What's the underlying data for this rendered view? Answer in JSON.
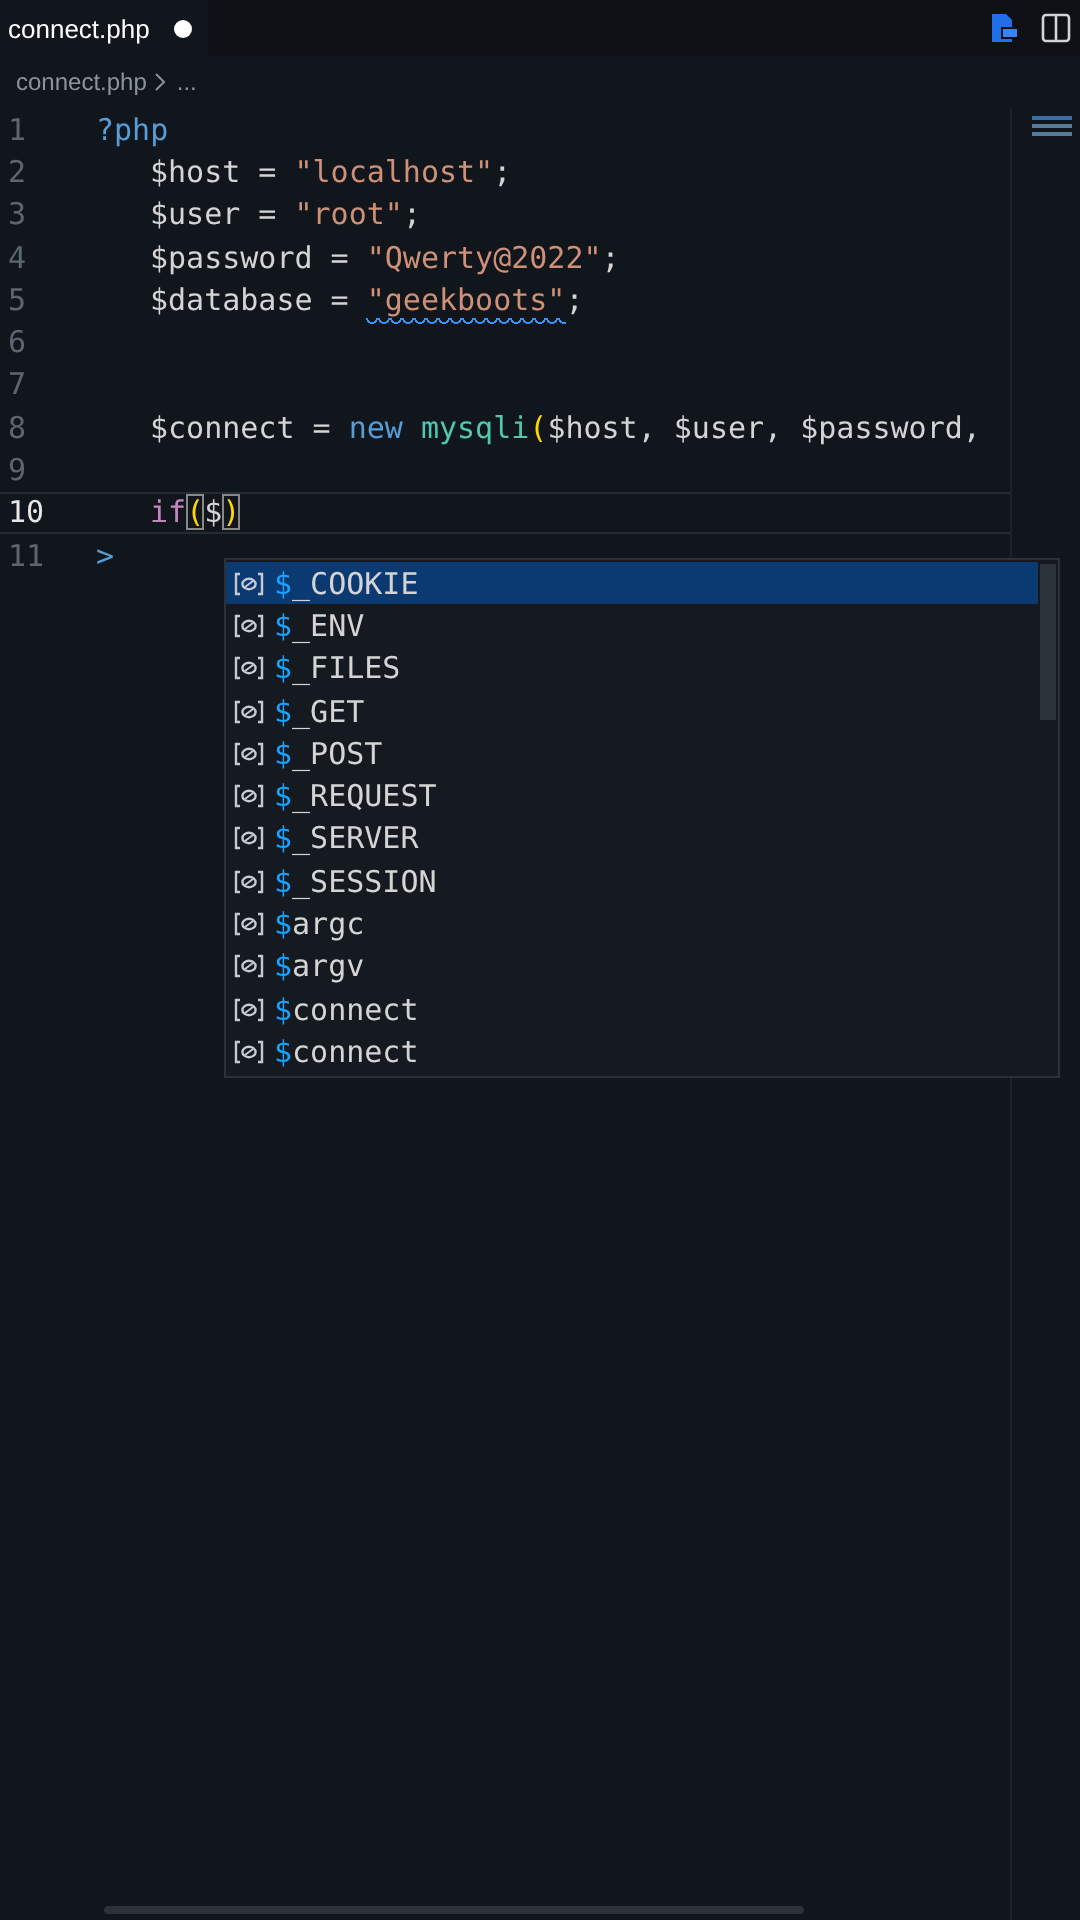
{
  "tab": {
    "label": "connect.php",
    "modified": true,
    "selected": true
  },
  "breadcrumb": [
    "connect.php",
    "..."
  ],
  "editor": {
    "lines": [
      {
        "number": "1",
        "indented": false,
        "current": false,
        "tokens": [
          {
            "kind": "keyword",
            "text": "?php"
          }
        ]
      },
      {
        "number": "2",
        "indented": true,
        "current": false,
        "tokens": [
          {
            "kind": "variable",
            "text": "$host"
          },
          {
            "kind": "plain",
            "text": " = "
          },
          {
            "kind": "string",
            "text": "\"localhost\""
          },
          {
            "kind": "plain",
            "text": ";"
          }
        ]
      },
      {
        "number": "3",
        "indented": true,
        "current": false,
        "tokens": [
          {
            "kind": "variable",
            "text": "$user"
          },
          {
            "kind": "plain",
            "text": " = "
          },
          {
            "kind": "string",
            "text": "\"root\""
          },
          {
            "kind": "plain",
            "text": ";"
          }
        ]
      },
      {
        "number": "4",
        "indented": true,
        "current": false,
        "tokens": [
          {
            "kind": "variable",
            "text": "$password"
          },
          {
            "kind": "plain",
            "text": " = "
          },
          {
            "kind": "string",
            "text": "\"Qwerty@2022\""
          },
          {
            "kind": "plain",
            "text": ";"
          }
        ]
      },
      {
        "number": "5",
        "indented": true,
        "current": false,
        "tokens": [
          {
            "kind": "variable",
            "text": "$database"
          },
          {
            "kind": "plain",
            "text": " = "
          },
          {
            "kind": "string",
            "text": "\"geekboots\"",
            "squiggle": true
          },
          {
            "kind": "plain",
            "text": ";"
          }
        ]
      },
      {
        "number": "6",
        "current": false
      },
      {
        "number": "7",
        "current": false
      },
      {
        "number": "8",
        "indented": true,
        "current": false,
        "tokens": [
          {
            "kind": "variable",
            "text": "$connect"
          },
          {
            "kind": "plain",
            "text": " = "
          },
          {
            "kind": "keyword",
            "text": "new "
          },
          {
            "kind": "function",
            "text": "mysqli"
          },
          {
            "kind": "paren",
            "text": "("
          },
          {
            "kind": "variable",
            "text": "$host, "
          },
          {
            "kind": "variable",
            "text": "$user, "
          },
          {
            "kind": "variable",
            "text": "$password,"
          }
        ]
      },
      {
        "number": "9",
        "current": false
      },
      {
        "number": "10",
        "indented": true,
        "current": true,
        "tokens": [
          {
            "kind": "control",
            "text": "if"
          },
          {
            "kind": "paren",
            "text": "(",
            "bracket_match": true
          },
          {
            "kind": "variable",
            "text": "$"
          },
          {
            "kind": "paren",
            "text": ")",
            "bracket_match": true
          }
        ]
      },
      {
        "number": "11",
        "indented": false,
        "current": false,
        "tokens": [
          {
            "kind": "fold",
            "text": ">"
          }
        ]
      }
    ]
  },
  "suggestions": [
    {
      "match": "$",
      "rest": "_COOKIE",
      "selected": true
    },
    {
      "match": "$",
      "rest": "_ENV",
      "selected": false
    },
    {
      "match": "$",
      "rest": "_FILES",
      "selected": false
    },
    {
      "match": "$",
      "rest": "_GET",
      "selected": false
    },
    {
      "match": "$",
      "rest": "_POST",
      "selected": false
    },
    {
      "match": "$",
      "rest": "_REQUEST",
      "selected": false
    },
    {
      "match": "$",
      "rest": "_SERVER",
      "selected": false
    },
    {
      "match": "$",
      "rest": "_SESSION",
      "selected": false
    },
    {
      "match": "$",
      "rest": "argc",
      "selected": false
    },
    {
      "match": "$",
      "rest": "argv",
      "selected": false
    },
    {
      "match": "$",
      "rest": "connect",
      "selected": false
    },
    {
      "match": "$",
      "rest": "connect",
      "selected": false
    }
  ]
}
